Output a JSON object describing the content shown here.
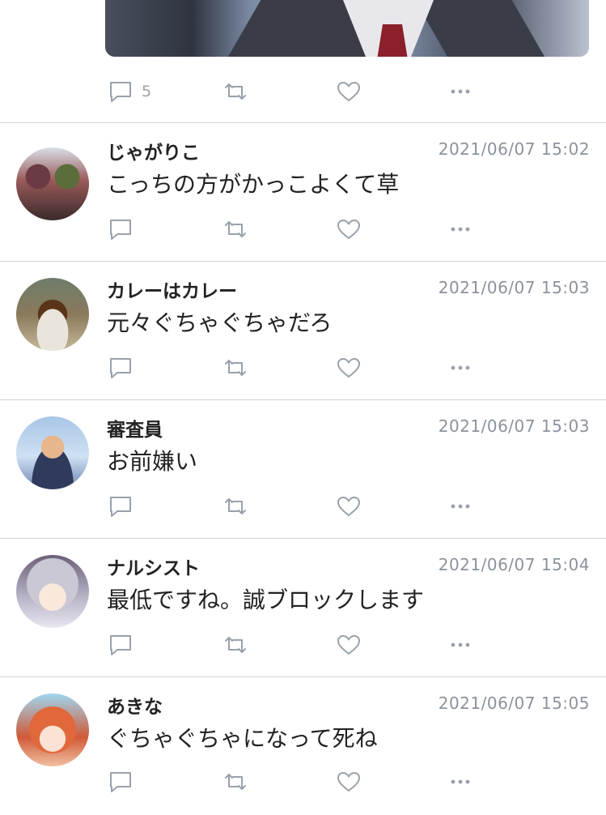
{
  "top_post": {
    "reply_count": "5"
  },
  "tweets": [
    {
      "name": "じゃがりこ",
      "time": "2021/06/07 15:02",
      "text": "こっちの方がかっこよくて草"
    },
    {
      "name": "カレーはカレー",
      "time": "2021/06/07 15:03",
      "text": "元々ぐちゃぐちゃだろ"
    },
    {
      "name": "審査員",
      "time": "2021/06/07 15:03",
      "text": "お前嫌い"
    },
    {
      "name": "ナルシスト",
      "time": "2021/06/07 15:04",
      "text": "最低ですね。誠ブロックします"
    },
    {
      "name": "あきな",
      "time": "2021/06/07 15:05",
      "text": "ぐちゃぐちゃになって死ね"
    }
  ],
  "icons": [
    "reply-icon",
    "retweet-icon",
    "like-icon",
    "more-icon"
  ],
  "colors": {
    "icon": "#9aa1ab",
    "divider": "#d2d3d6",
    "timestamp": "#8b929c"
  }
}
